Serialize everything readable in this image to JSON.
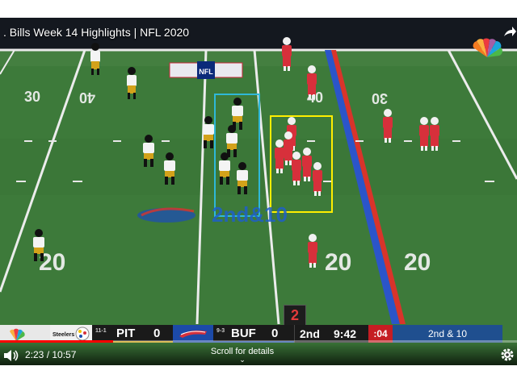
{
  "video": {
    "title": ". Bills Week 14 Highlights | NFL 2020",
    "network_logo": "nbc-peacock-icon",
    "share_icon": "share-arrow-icon"
  },
  "field": {
    "yard_markers_top": [
      "30",
      "40",
      "40",
      "30"
    ],
    "yard_markers_bottom": [
      "20",
      "20",
      "20"
    ],
    "line_to_gain_color": "#d9342b",
    "scrimmage_color": "#2b55c9",
    "down_distance_overlay": "2nd&10",
    "annotation_box_colors": {
      "offense": "#ffee00",
      "defense": "#2fb8d8"
    },
    "down_badge": "2"
  },
  "scorebug": {
    "away_team": "PIT",
    "away_record": "11-1",
    "away_score": "0",
    "home_team": "BUF",
    "home_record": "9-3",
    "home_score": "0",
    "quarter": "2nd",
    "clock": "9:42",
    "play_clock": ":04",
    "down_distance": "2nd & 10",
    "colors": {
      "away": "#d1a100",
      "home": "#1c4aa8",
      "play_clock": "#c51d23"
    }
  },
  "player": {
    "current_time": "2:23",
    "duration": "10:57",
    "time_display": "2:23 / 10:57",
    "progress": 0.218,
    "scroll_hint": "Scroll for details",
    "volume_icon": "volume-icon",
    "settings_icon": "gear-icon"
  }
}
